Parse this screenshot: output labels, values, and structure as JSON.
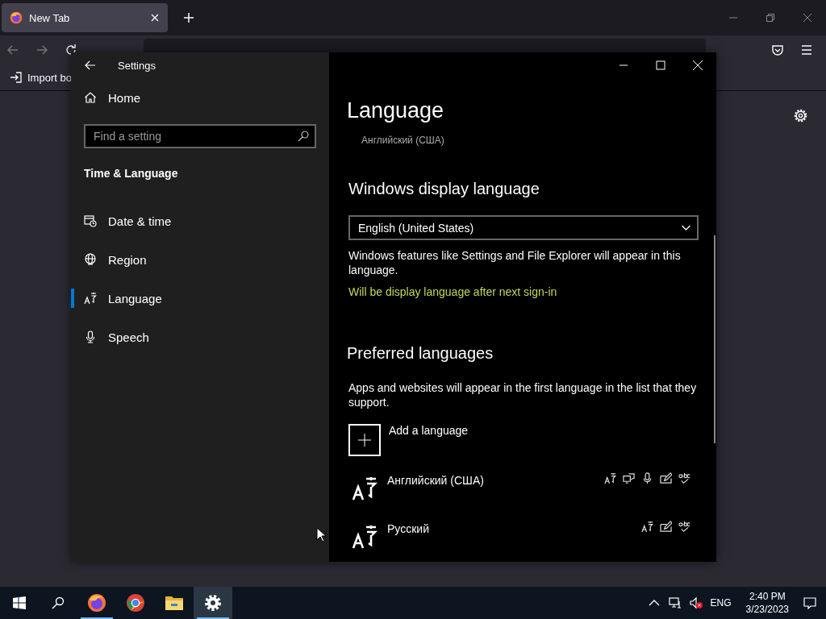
{
  "browser": {
    "tab": {
      "title": "New Tab",
      "selected": true
    },
    "bookmarks": [
      {
        "label": "Import bo"
      }
    ]
  },
  "settings": {
    "title": "Settings",
    "home": "Home",
    "search": {
      "placeholder": "Find a setting"
    },
    "section": "Time & Language",
    "nav": [
      {
        "label": "Date & time",
        "kind": "calendar",
        "selected": false
      },
      {
        "label": "Region",
        "kind": "globe",
        "selected": false
      },
      {
        "label": "Language",
        "kind": "language",
        "selected": true
      },
      {
        "label": "Speech",
        "kind": "mic",
        "selected": false
      }
    ],
    "page": {
      "title": "Language",
      "current_language": "Английский (США)",
      "display_heading": "Windows display language",
      "display_value": "English (United States)",
      "display_desc": "Windows features like Settings and File Explorer will appear in this language.",
      "display_note": "Will be display language after next sign-in",
      "preferred_heading": "Preferred languages",
      "preferred_desc": "Apps and websites will appear in the first language in the list that they support.",
      "add_label": "Add a language",
      "languages": [
        {
          "name": "Английский (США)",
          "features": [
            {
              "kind": "language"
            },
            {
              "kind": "speech"
            },
            {
              "kind": "mic"
            },
            {
              "kind": "handwriting"
            },
            {
              "kind": "spelling"
            }
          ]
        },
        {
          "name": "Русский",
          "features": [
            {
              "kind": "language"
            },
            {
              "kind": "handwriting"
            },
            {
              "kind": "spelling"
            }
          ]
        }
      ]
    }
  },
  "taskbar": {
    "apps": [
      {
        "kind": "firefox",
        "running": true,
        "selected": false
      },
      {
        "kind": "chrome",
        "running": false,
        "selected": false
      },
      {
        "kind": "folder",
        "running": false,
        "selected": false
      },
      {
        "kind": "gear",
        "running": true,
        "selected": true
      }
    ],
    "tray": {
      "input": "ENG",
      "time": "2:40 PM",
      "date": "3/23/2023"
    }
  }
}
